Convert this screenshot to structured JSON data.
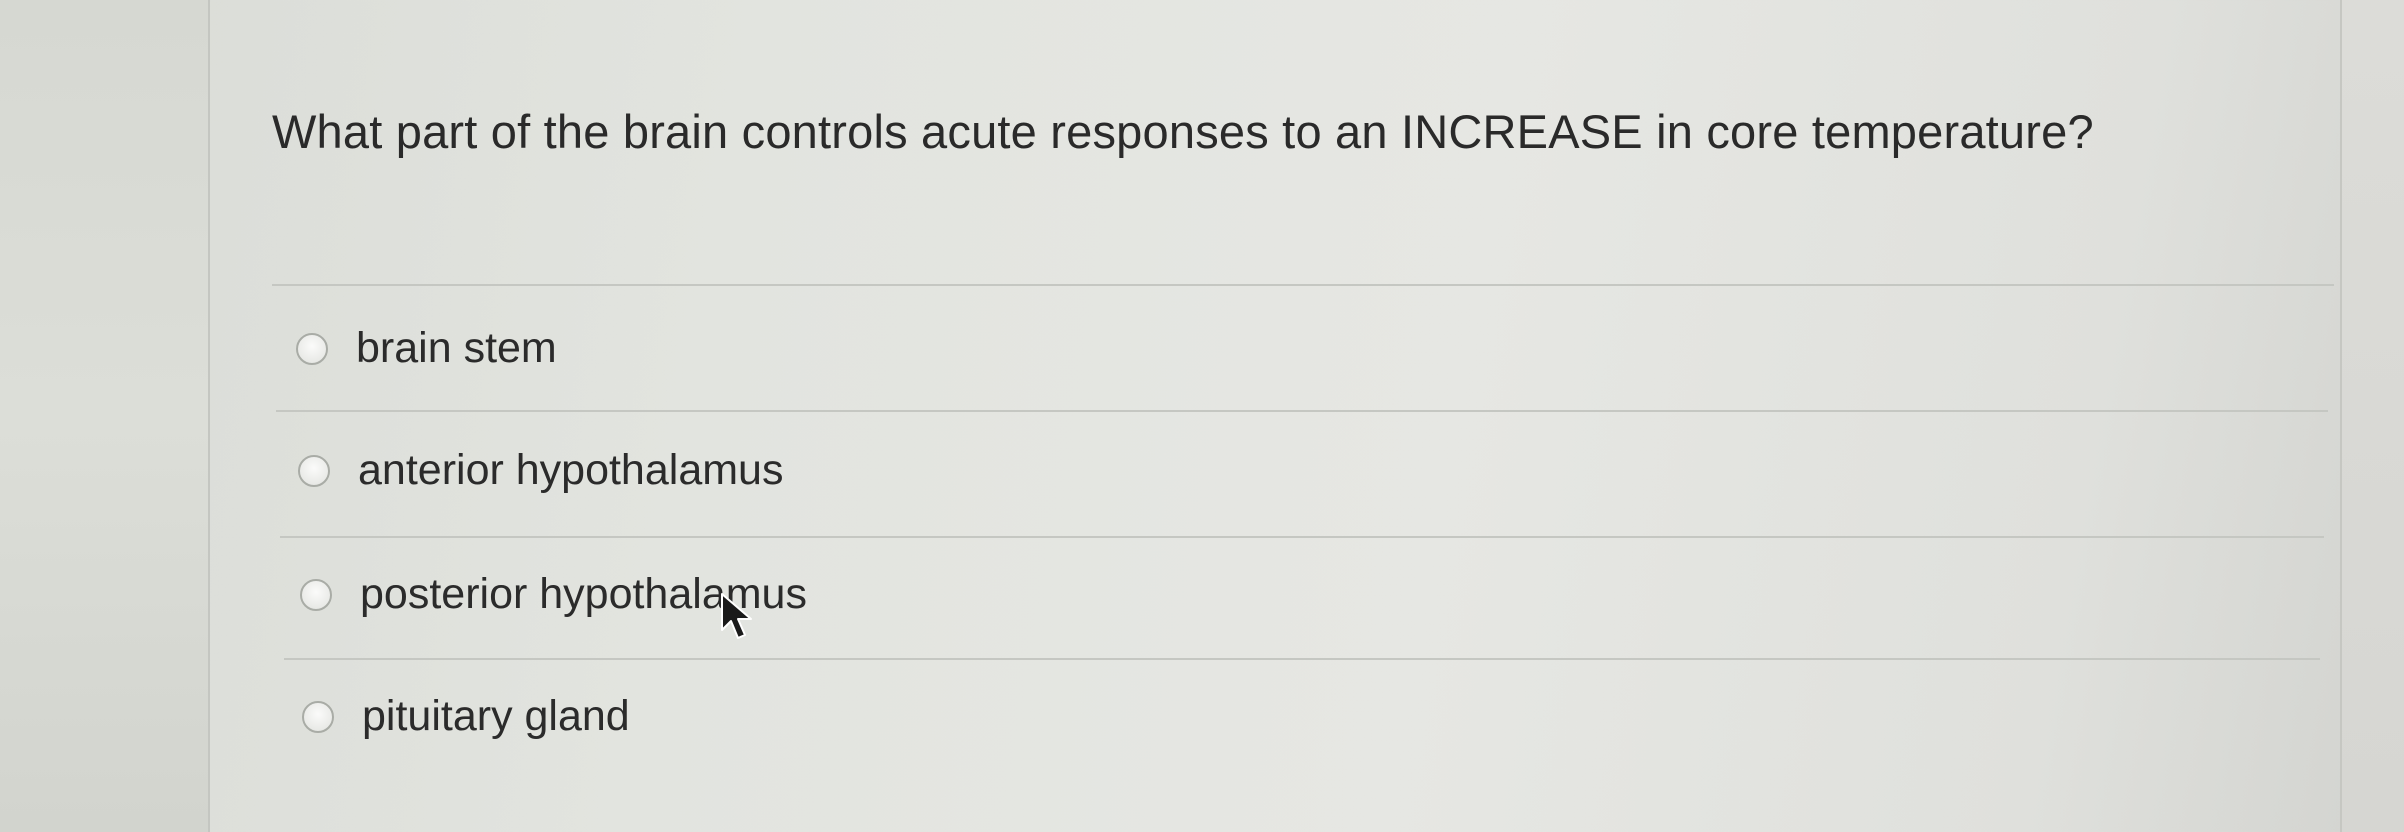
{
  "question": {
    "text": "What part of the brain controls acute responses to an INCREASE in core temperature?"
  },
  "options": [
    {
      "label": "brain stem",
      "selected": false
    },
    {
      "label": "anterior hypothalamus",
      "selected": false
    },
    {
      "label": "posterior hypothalamus",
      "selected": false
    },
    {
      "label": "pituitary gland",
      "selected": false
    }
  ],
  "icons": {
    "cursor": "arrow-cursor-icon",
    "radio": "radio-unselected-icon"
  }
}
